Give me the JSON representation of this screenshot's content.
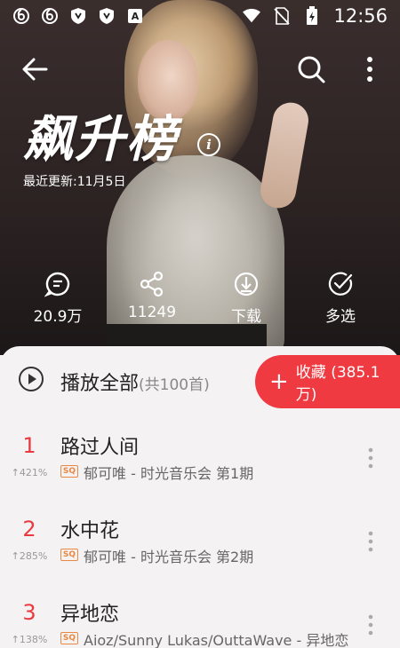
{
  "status_bar": {
    "time": "12:56",
    "left_icons": [
      "netease-music-icon",
      "netease-music-icon",
      "shield-icon",
      "shield-icon",
      "a-badge-icon"
    ],
    "right_icons": [
      "wifi-icon",
      "no-sim-icon",
      "battery-charging-icon"
    ]
  },
  "header": {
    "title": "飙升榜",
    "updated": "最近更新:11月5日",
    "info_glyph": "i"
  },
  "actions": [
    {
      "label": "20.9万",
      "icon": "comment-icon"
    },
    {
      "label": "11249",
      "icon": "share-icon"
    },
    {
      "label": "下载",
      "icon": "download-icon"
    },
    {
      "label": "多选",
      "icon": "multi-select-icon"
    }
  ],
  "playall": {
    "label": "播放全部",
    "count": "(共100首)"
  },
  "collect": {
    "plus": "+",
    "label": "收藏 (385.1万)"
  },
  "songs": [
    {
      "rank": "1",
      "trend": "↑421%",
      "title": "路过人间",
      "quality": "SQ",
      "subtitle": "郁可唯 - 时光音乐会 第1期"
    },
    {
      "rank": "2",
      "trend": "↑285%",
      "title": "水中花",
      "quality": "SQ",
      "subtitle": "郁可唯 - 时光音乐会 第2期"
    },
    {
      "rank": "3",
      "trend": "↑138%",
      "title": "异地恋",
      "quality": "SQ",
      "subtitle": "Aioz/Sunny Lukas/OuttaWave - 异地恋"
    }
  ],
  "colors": {
    "accent": "#ee3a40",
    "rank": "#e83a3f",
    "sq": "#e98845"
  }
}
